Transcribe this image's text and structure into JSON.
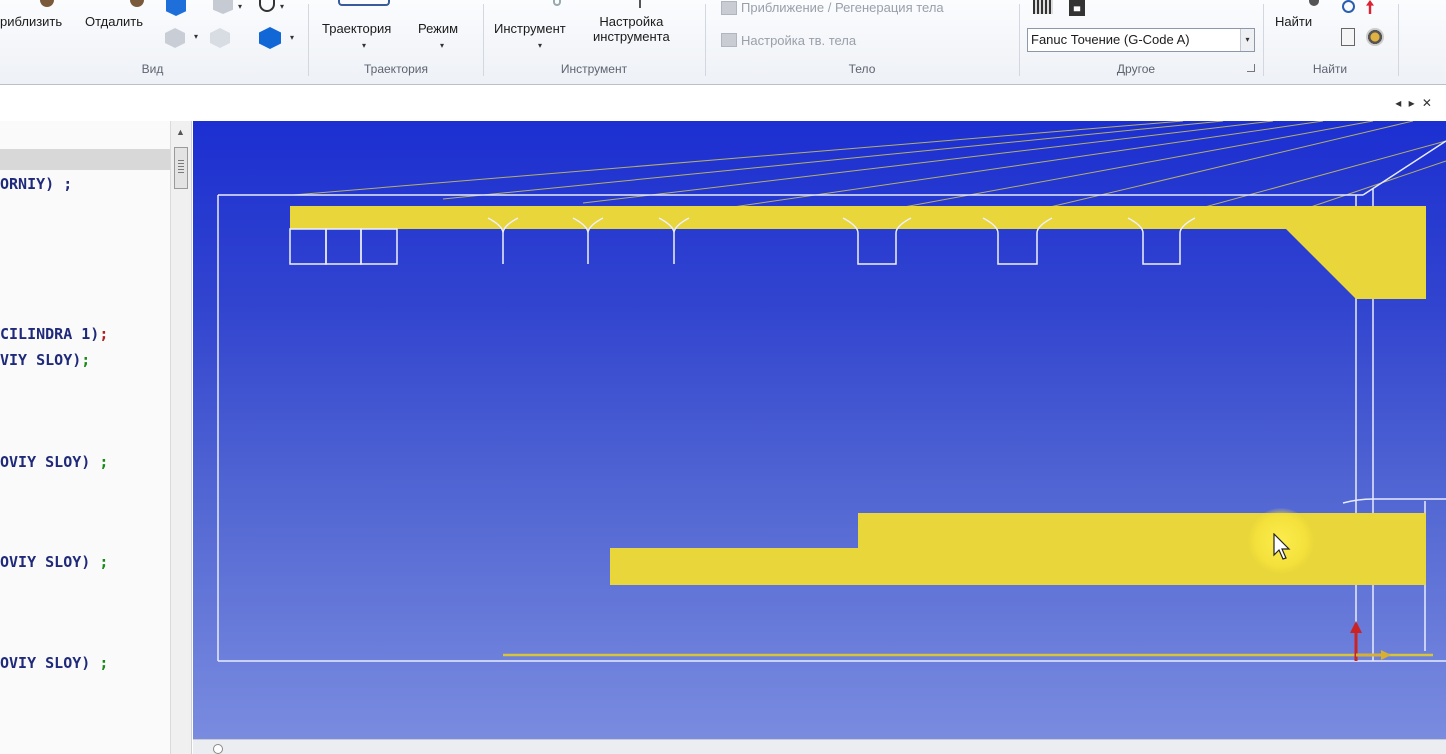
{
  "ribbon": {
    "view": {
      "zoom_in_label": "риблизить",
      "zoom_out_label": "Отдалить",
      "group_label": "Вид"
    },
    "trajectory": {
      "trajectory_label": "Траектория",
      "mode_label": "Режим",
      "group_label": "Траектория"
    },
    "tool": {
      "tool_label": "Инструмент",
      "tool_setup_line1": "Настройка",
      "tool_setup_line2": "инструмента",
      "group_label": "Инструмент"
    },
    "body": {
      "approx_regen_label": "Приближение / Регенерация тела",
      "solid_setup_label": "Настройка тв. тела",
      "group_label": "Тело"
    },
    "other": {
      "postprocessor_value": "Fanuc Точение (G-Code A)",
      "group_label": "Другое"
    },
    "find": {
      "find_label": "Найти",
      "group_label": "Найти"
    }
  },
  "doc_controls": "◂ ▸ ✕",
  "code_panel": {
    "lines": [
      {
        "text": "ORNIY)",
        "semi_color": "black"
      },
      {
        "text": "CILINDRA 1)",
        "semi_color": "red"
      },
      {
        "text": "VIY SLOY)",
        "semi_color": "green"
      },
      {
        "text": "OVIY SLOY)",
        "semi_color": "green"
      },
      {
        "text": "OVIY SLOY)",
        "semi_color": "green"
      },
      {
        "text": "OVIY SLOY)",
        "semi_color": "green"
      }
    ],
    "semicolon": ";"
  },
  "colors": {
    "viewport_top": "#1c2fd1",
    "viewport_bottom": "#7c8ee0",
    "stock_yellow": "#e8d63a",
    "wire_white": "#e8ecff",
    "code_blue": "#1f2a7a",
    "semi_green": "#178a17",
    "semi_red": "#b02020"
  }
}
